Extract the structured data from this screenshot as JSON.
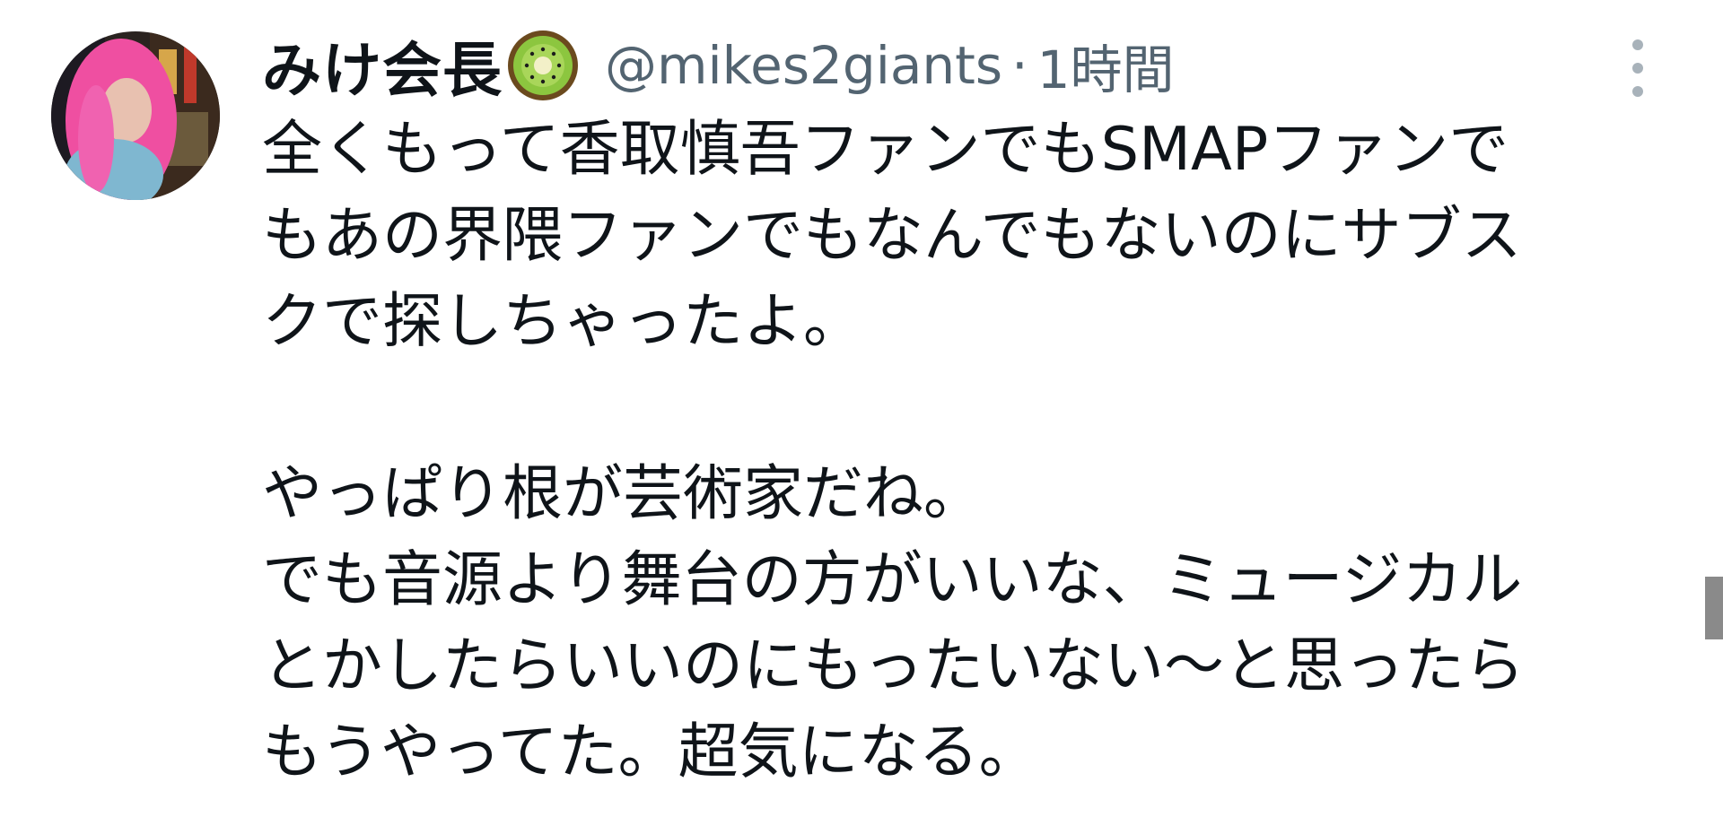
{
  "author": {
    "display_name": "みけ会長",
    "emoji_icon": "kiwi-icon",
    "handle": "@mikes2giants",
    "separator": "·",
    "time": "1時間"
  },
  "tweet": {
    "lines": [
      "全くもって香取慎吾ファンでもSMAPファンで",
      "もあの界隈ファンでもなんでもないのにサブス",
      "クで探しちゃったよ。",
      "",
      "やっぱり根が芸術家だね。",
      "でも音源より舞台の方がいいな、ミュージカル",
      "とかしたらいいのにもったいない〜と思ったら",
      "もうやってた。超気になる。"
    ]
  },
  "colors": {
    "text": "#0f1419",
    "secondary": "#536471",
    "more_dots": "#a8b2ba"
  }
}
